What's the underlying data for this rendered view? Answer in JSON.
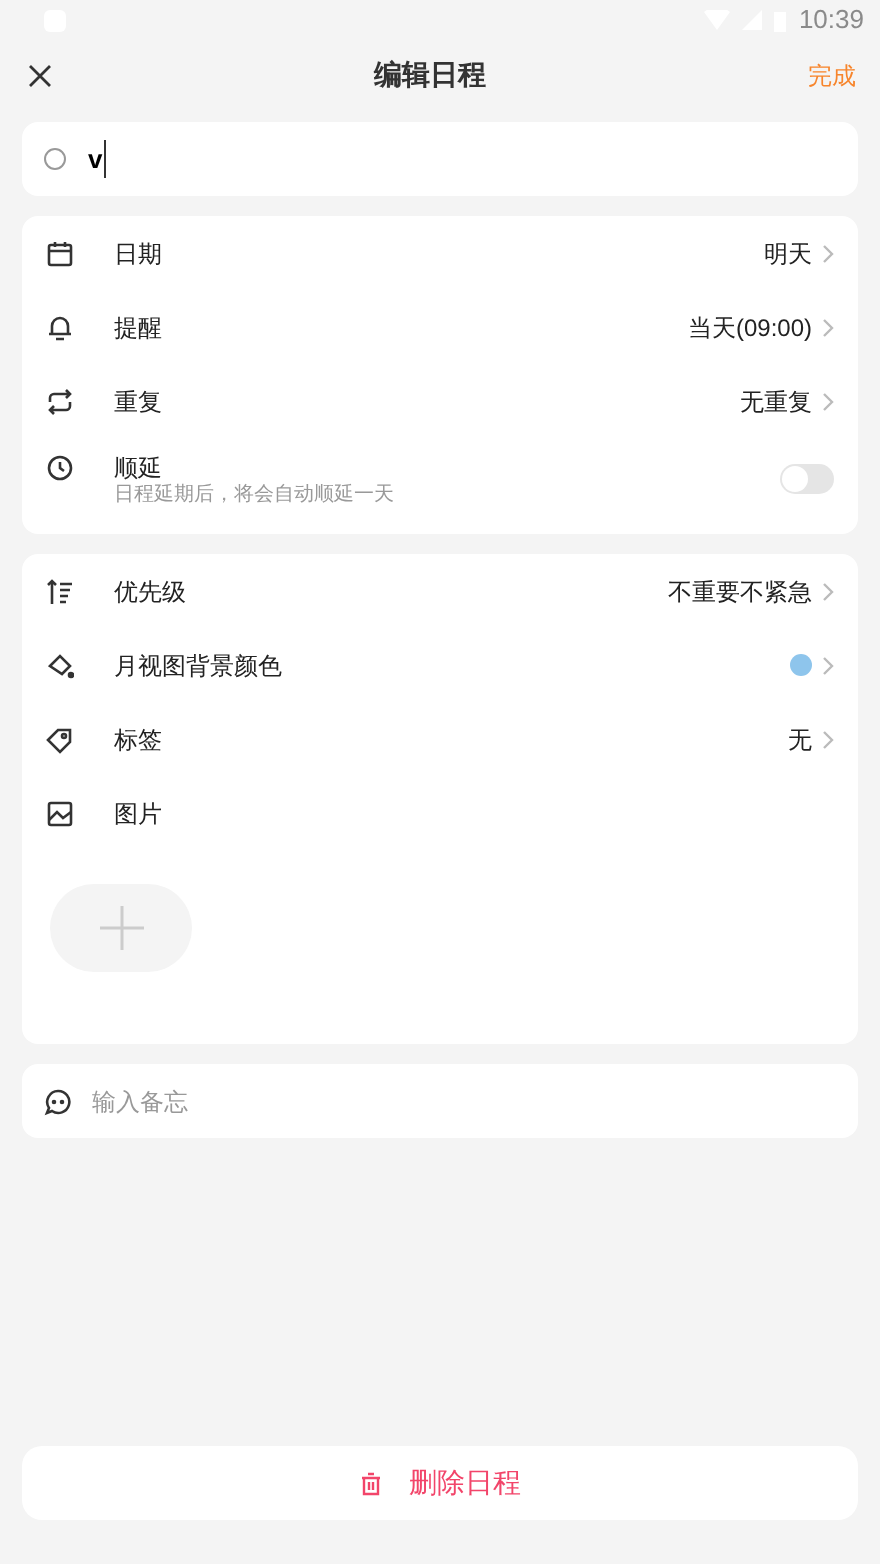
{
  "status_bar": {
    "time": "10:39"
  },
  "header": {
    "title": "编辑日程",
    "done": "完成"
  },
  "title_field": {
    "value": "v",
    "checked": false
  },
  "settings": [
    {
      "kind": "value",
      "label": "日期",
      "value": "明天"
    },
    {
      "kind": "value",
      "label": "提醒",
      "value": "当天(09:00)"
    },
    {
      "kind": "value",
      "label": "重复",
      "value": "无重复"
    },
    {
      "kind": "toggle",
      "label": "顺延",
      "hint": "日程延期后，将会自动顺延一天",
      "on": false
    }
  ],
  "details": [
    {
      "kind": "value",
      "label": "优先级",
      "value": "不重要不紧急"
    },
    {
      "kind": "color",
      "label": "月视图背景颜色",
      "color": "#8ec5ec"
    },
    {
      "kind": "value",
      "label": "标签",
      "value": "无"
    },
    {
      "kind": "images",
      "label": "图片"
    }
  ],
  "note": {
    "placeholder": "输入备忘"
  },
  "delete_button": "删除日程"
}
